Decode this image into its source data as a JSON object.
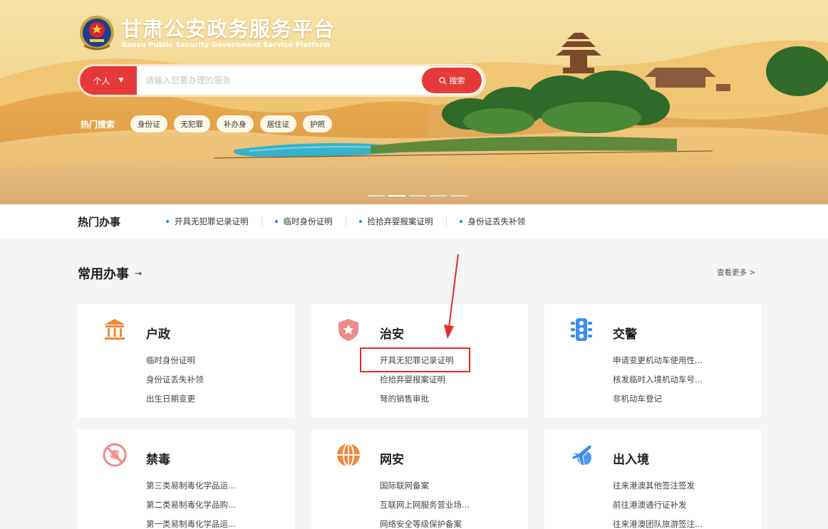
{
  "header": {
    "title": "甘肃公安政务服务平台",
    "subtitle": "Gansu Public Security Government Service Platform"
  },
  "search": {
    "type_label": "个人",
    "placeholder": "请输入您要办理的服务",
    "button_label": "搜索"
  },
  "hot_search": {
    "label": "热门搜索",
    "chips": [
      "身份证",
      "无犯罪",
      "补办身",
      "居住证",
      "护照"
    ]
  },
  "hot_affairs": {
    "title": "热门办事",
    "items": [
      "开具无犯罪记录证明",
      "临时身份证明",
      "捡拾弃婴报案证明",
      "身份证丢失补领"
    ]
  },
  "common": {
    "title": "常用办事",
    "arrow": "→",
    "more": "查看更多 >"
  },
  "cards": [
    {
      "title": "户政",
      "icon": "government-building-icon",
      "links": [
        "临时身份证明",
        "身份证丢失补领",
        "出生日期变更"
      ]
    },
    {
      "title": "治安",
      "icon": "police-shield-icon",
      "links": [
        "开具无犯罪记录证明",
        "捡拾弃婴报案证明",
        "弩的销售审批"
      ]
    },
    {
      "title": "交警",
      "icon": "traffic-light-icon",
      "links": [
        "申请变更机动车使用性...",
        "核发临时入境机动车号...",
        "非机动车登记"
      ]
    },
    {
      "title": "禁毒",
      "icon": "no-drugs-icon",
      "links": [
        "第三类易制毒化学品运...",
        "第二类易制毒化学品购...",
        "第一类易制毒化学品运..."
      ]
    },
    {
      "title": "网安",
      "icon": "globe-icon",
      "links": [
        "国际联网备案",
        "互联网上网服务营业场...",
        "网络安全等级保护备案"
      ]
    },
    {
      "title": "出入境",
      "icon": "airplane-icon",
      "links": [
        "往来港澳其他签注签发",
        "前往港澳通行证补发",
        "往来港澳团队旅游签注..."
      ]
    }
  ],
  "icons": {
    "emblem": "police-emblem-icon",
    "dropdown": "caret-down-icon",
    "search": "search-icon"
  },
  "colors": {
    "accent_red": "#e63a3a",
    "bullet_blue": "#2f7ff5",
    "icon_orange": "#f0893a",
    "icon_pink": "#f08a8a",
    "icon_blue": "#3d8ef0"
  }
}
